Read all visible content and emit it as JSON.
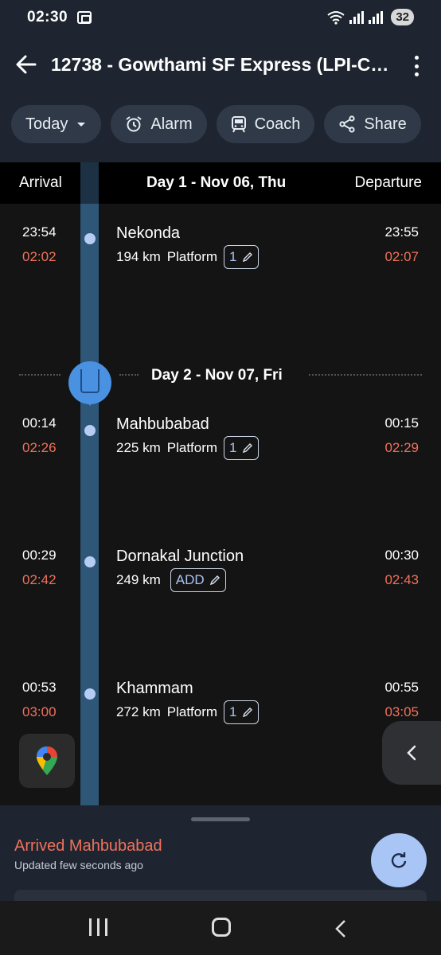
{
  "status_bar": {
    "time": "02:30",
    "battery": "32"
  },
  "app_bar": {
    "title": "12738 - Gowthami SF Express (LPI-CO...",
    "chips": [
      {
        "label": "Today",
        "icon": "chevron-down-icon"
      },
      {
        "label": "Alarm",
        "icon": "alarm-clock-icon"
      },
      {
        "label": "Coach",
        "icon": "train-coach-icon"
      },
      {
        "label": "Share",
        "icon": "share-icon"
      }
    ]
  },
  "timeline": {
    "arrival_label": "Arrival",
    "departure_label": "Departure",
    "day1_label": "Day 1 - Nov 06, Thu",
    "day2_label": "Day 2 - Nov 07, Fri",
    "platform_label": "Platform",
    "add_label": "ADD",
    "stops": [
      {
        "name": "Nekonda",
        "distance": "194 km",
        "sched_arr": "23:54",
        "act_arr": "02:02",
        "sched_dep": "23:55",
        "act_dep": "02:07",
        "platform": "1"
      },
      {
        "name": "Mahbubabad",
        "distance": "225 km",
        "sched_arr": "00:14",
        "act_arr": "02:26",
        "sched_dep": "00:15",
        "act_dep": "02:29",
        "platform": "1"
      },
      {
        "name": "Dornakal Junction",
        "distance": "249 km",
        "sched_arr": "00:29",
        "act_arr": "02:42",
        "sched_dep": "00:30",
        "act_dep": "02:43",
        "platform": ""
      },
      {
        "name": "Khammam",
        "distance": "272 km",
        "sched_arr": "00:53",
        "act_arr": "03:00",
        "sched_dep": "00:55",
        "act_dep": "03:05",
        "platform": "1"
      }
    ]
  },
  "bottom_sheet": {
    "status": "Arrived Mahbubabad",
    "updated": "Updated few seconds ago"
  },
  "colors": {
    "accent": "#a9c5f5",
    "delay": "#f0715c",
    "track": "#2d5677",
    "bar": "#1e2530"
  }
}
